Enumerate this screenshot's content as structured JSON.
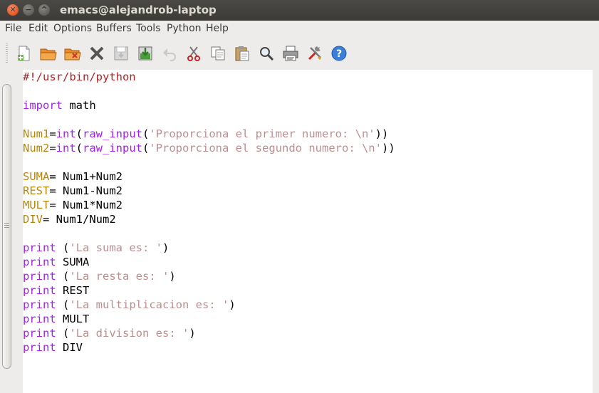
{
  "window": {
    "title": "emacs@alejandrob-laptop",
    "controls": {
      "close": "✕",
      "minimize": "−",
      "maximize": "^"
    }
  },
  "menubar": {
    "items": [
      "File",
      "Edit",
      "Options",
      "Buffers",
      "Tools",
      "Python",
      "Help"
    ]
  },
  "toolbar": {
    "buttons": [
      "new-file-icon",
      "open-folder-icon",
      "dired-icon",
      "close-buffer-icon",
      "save-icon",
      "save-as-icon",
      "undo-icon",
      "cut-icon",
      "copy-icon",
      "paste-icon",
      "search-icon",
      "print-icon",
      "preferences-icon",
      "help-icon"
    ]
  },
  "colors": {
    "keyword": "#a020f0",
    "variable": "#b8860b",
    "string": "#bc8f8f",
    "comment": "#b22222"
  },
  "code": {
    "line1": "#!/usr/bin/python",
    "line3_kw": "import",
    "line3_rest": " math",
    "line5": {
      "var": "Num1",
      "eq": "=",
      "fn": "int",
      "p1": "(",
      "fn2": "raw_input",
      "p2": "(",
      "str": "'Proporciona el primer numero: \\n'",
      "close": "))"
    },
    "line6": {
      "var": "Num2",
      "eq": "=",
      "fn": "int",
      "p1": "(",
      "fn2": "raw_input",
      "p2": "(",
      "str": "'Proporciona el segundo numero: \\n'",
      "close": "))"
    },
    "line8": {
      "var": "SUMA",
      "rest": "= Num1+Num2"
    },
    "line9": {
      "var": "REST",
      "rest": "= Num1-Num2"
    },
    "line10": {
      "var": "MULT",
      "rest": "= Num1*Num2"
    },
    "line11": {
      "var": "DIV",
      "rest": "= Num1/Num2"
    },
    "line13": {
      "kw": "print",
      "open": " (",
      "str": "'La suma es: '",
      "close": ")"
    },
    "line14": {
      "kw": "print",
      "rest": " SUMA"
    },
    "line15": {
      "kw": "print",
      "open": " (",
      "str": "'La resta es: '",
      "close": ")"
    },
    "line16": {
      "kw": "print",
      "rest": " REST"
    },
    "line17": {
      "kw": "print",
      "open": " (",
      "str": "'La multiplicacion es: '",
      "close": ")"
    },
    "line18": {
      "kw": "print",
      "rest": " MULT"
    },
    "line19": {
      "kw": "print",
      "open": " (",
      "str": "'La division es: '",
      "close": ")"
    },
    "line20": {
      "kw": "print",
      "rest": " DIV"
    }
  }
}
